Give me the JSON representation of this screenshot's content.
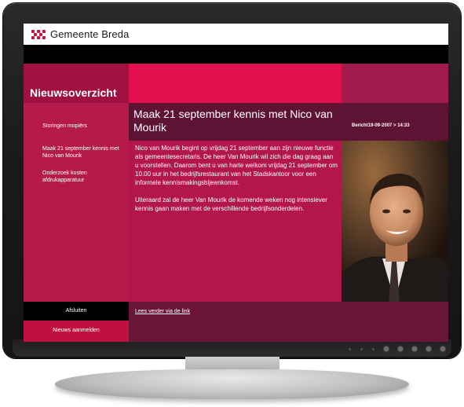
{
  "header": {
    "brand": "Gemeente Breda"
  },
  "sidebar": {
    "title": "Nieuwsoverzicht",
    "items": [
      {
        "label": "Storingen mopiërs"
      },
      {
        "label": "Maak 21 september kennis met Nico van Mourik"
      },
      {
        "label": "Onderzoek kosten afdrukapparatuur"
      }
    ],
    "close_label": "Afsluiten",
    "subscribe_label": "Nieuws aanmelden"
  },
  "article": {
    "title": "Maak 21 september kennis met Nico van Mourik",
    "meta": "Bericht19-09-2007 > 14:33",
    "paragraphs": [
      "Nico van Mourik begint op vrijdag 21 september aan zijn nieuwe functie als gemeentesecretaris. De heer Van Mourik wil zich die dag graag aan u voorstellen. Daarom bent u van harte welkom vrijdag 21 september om 10.00 uur in het bedrijfsrestaurant van het Stadskantoor voor een informele kennismakingsbijeenkomst.",
      "Uiteraard zal de heer Van Mourik de komende weken nog intensiever kennis gaan maken met de verschillende bedrijfsonderdelen."
    ],
    "link_label": "Lees verder via de link"
  },
  "colors": {
    "accent": "#e3104f",
    "sidebar": "#b41a4a",
    "dark": "#5e1335"
  }
}
